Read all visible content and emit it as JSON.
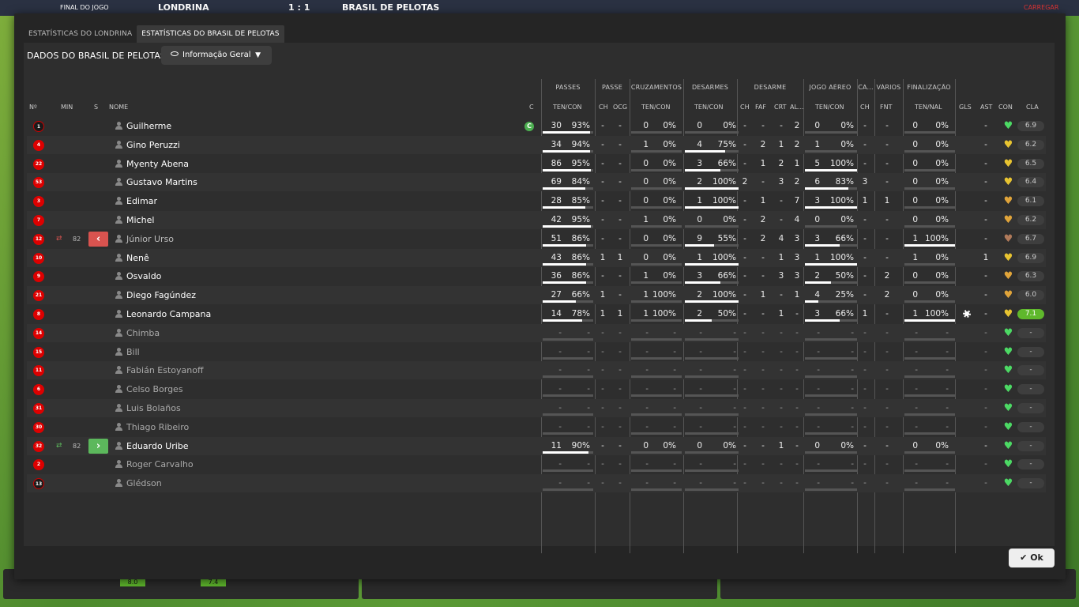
{
  "topbar": {
    "left_label": "FINAL DO JOGO",
    "home_team": "LONDRINA",
    "score": "1 : 1",
    "away_team": "BRASIL DE PELOTAS",
    "right_label": "CARREGAR"
  },
  "tabs": [
    {
      "label": "ESTATÍSTICAS DO LONDRINA",
      "active": false
    },
    {
      "label": "ESTATÍSTICAS DO BRASIL DE PELOTAS",
      "active": true
    }
  ],
  "section_title": "DADOS DO BRASIL DE PELOTAS",
  "view_dropdown": {
    "value": "Informação Geral",
    "icon": "eye-icon"
  },
  "groups": [
    "PASSES",
    "PASSE",
    "CRUZAMENTOS",
    "DESARMES",
    "DESARME",
    "JOGO AÉREO",
    "CA...",
    "VÁRIOS",
    "FINALIZAÇÃO"
  ],
  "columns": {
    "num": "Nº",
    "min": "MIN",
    "s": "S",
    "name": "NOME",
    "cap": "C",
    "pass_tc": "TEN/CON",
    "pass_ch": "CH",
    "pass_ocg": "OCG",
    "cross_tc": "TEN/CON",
    "tack_tc": "TEN/CON",
    "des_ch": "CH",
    "des_faf": "FAF",
    "des_crt": "CRT",
    "des_al": "AL...",
    "air_tc": "TEN/CON",
    "ca_ch": "CH",
    "var_fnt": "FNT",
    "fin_tn": "TEN/NAL",
    "gls": "GLS",
    "ast": "AST",
    "con": "CON",
    "cla": "CLA"
  },
  "players": [
    {
      "num": "1",
      "gk": true,
      "name": "Guilherme",
      "cap": "C",
      "p": [
        "30",
        "93%"
      ],
      "pch": "-",
      "pocg": "-",
      "cr": [
        "0",
        "0%"
      ],
      "tk": [
        "0",
        "0%"
      ],
      "d": [
        "-",
        "-",
        "-",
        "2"
      ],
      "air": [
        "0",
        "0%"
      ],
      "cach": "-",
      "fnt": "-",
      "fin": [
        "0",
        "0%"
      ],
      "gls": "",
      "ast": "-",
      "con": "green",
      "cla": "6.9",
      "pass_pct": 0.93,
      "tk_pct": 0,
      "air_pct": 0,
      "fin_pct": 0
    },
    {
      "num": "4",
      "name": "Gino Peruzzi",
      "p": [
        "34",
        "94%"
      ],
      "pch": "-",
      "pocg": "-",
      "cr": [
        "1",
        "0%"
      ],
      "tk": [
        "4",
        "75%"
      ],
      "d": [
        "-",
        "2",
        "1",
        "2"
      ],
      "air": [
        "1",
        "0%"
      ],
      "cach": "-",
      "fnt": "-",
      "fin": [
        "0",
        "0%"
      ],
      "gls": "",
      "ast": "-",
      "con": "gold",
      "cla": "6.2",
      "pass_pct": 0.94,
      "tk_pct": 0.75,
      "air_pct": 0,
      "fin_pct": 0
    },
    {
      "num": "22",
      "name": "Myenty Abena",
      "p": [
        "86",
        "95%"
      ],
      "pch": "-",
      "pocg": "-",
      "cr": [
        "0",
        "0%"
      ],
      "tk": [
        "3",
        "66%"
      ],
      "d": [
        "-",
        "1",
        "2",
        "1"
      ],
      "air": [
        "5",
        "100%"
      ],
      "cach": "-",
      "fnt": "-",
      "fin": [
        "0",
        "0%"
      ],
      "gls": "",
      "ast": "-",
      "con": "gold",
      "cla": "6.5",
      "pass_pct": 0.95,
      "tk_pct": 0.66,
      "air_pct": 1,
      "fin_pct": 0
    },
    {
      "num": "53",
      "name": "Gustavo Martins",
      "p": [
        "69",
        "84%"
      ],
      "pch": "-",
      "pocg": "-",
      "cr": [
        "0",
        "0%"
      ],
      "tk": [
        "2",
        "100%"
      ],
      "d": [
        "2",
        "-",
        "3",
        "2"
      ],
      "air": [
        "6",
        "83%"
      ],
      "cach": "3",
      "fnt": "-",
      "fin": [
        "0",
        "0%"
      ],
      "gls": "",
      "ast": "-",
      "con": "gold",
      "cla": "6.4",
      "pass_pct": 0.84,
      "tk_pct": 1,
      "air_pct": 0.83,
      "fin_pct": 0
    },
    {
      "num": "3",
      "name": "Edimar",
      "p": [
        "28",
        "85%"
      ],
      "pch": "-",
      "pocg": "-",
      "cr": [
        "0",
        "0%"
      ],
      "tk": [
        "1",
        "100%"
      ],
      "d": [
        "-",
        "1",
        "-",
        "7"
      ],
      "air": [
        "3",
        "100%"
      ],
      "cach": "1",
      "fnt": "1",
      "fin": [
        "0",
        "0%"
      ],
      "gls": "",
      "ast": "-",
      "con": "orange",
      "cla": "6.1",
      "pass_pct": 0.85,
      "tk_pct": 1,
      "air_pct": 1,
      "fin_pct": 0
    },
    {
      "num": "7",
      "name": "Michel",
      "p": [
        "42",
        "95%"
      ],
      "pch": "-",
      "pocg": "-",
      "cr": [
        "1",
        "0%"
      ],
      "tk": [
        "0",
        "0%"
      ],
      "d": [
        "-",
        "2",
        "-",
        "4"
      ],
      "air": [
        "0",
        "0%"
      ],
      "cach": "-",
      "fnt": "-",
      "fin": [
        "0",
        "0%"
      ],
      "gls": "",
      "ast": "-",
      "con": "orange",
      "cla": "6.2",
      "pass_pct": 0.95,
      "tk_pct": 0,
      "air_pct": 0,
      "fin_pct": 0
    },
    {
      "num": "12",
      "name": "Júnior Urso",
      "sub": "out",
      "min": "82",
      "faded": true,
      "p": [
        "51",
        "86%"
      ],
      "pch": "-",
      "pocg": "-",
      "cr": [
        "0",
        "0%"
      ],
      "tk": [
        "9",
        "55%"
      ],
      "d": [
        "-",
        "2",
        "4",
        "3"
      ],
      "air": [
        "3",
        "66%"
      ],
      "cach": "-",
      "fnt": "-",
      "fin": [
        "1",
        "100%"
      ],
      "gls": "",
      "ast": "-",
      "con": "brown",
      "cla": "6.7",
      "pass_pct": 0.86,
      "tk_pct": 0.55,
      "air_pct": 0.66,
      "fin_pct": 1
    },
    {
      "num": "10",
      "name": "Nenê",
      "p": [
        "43",
        "86%"
      ],
      "pch": "1",
      "pocg": "1",
      "cr": [
        "0",
        "0%"
      ],
      "tk": [
        "1",
        "100%"
      ],
      "d": [
        "-",
        "-",
        "1",
        "3"
      ],
      "air": [
        "1",
        "100%"
      ],
      "cach": "-",
      "fnt": "-",
      "fin": [
        "1",
        "0%"
      ],
      "gls": "",
      "ast": "1",
      "con": "gold",
      "cla": "6.9",
      "pass_pct": 0.86,
      "tk_pct": 1,
      "air_pct": 1,
      "fin_pct": 0
    },
    {
      "num": "9",
      "name": "Osvaldo",
      "p": [
        "36",
        "86%"
      ],
      "pch": "-",
      "pocg": "-",
      "cr": [
        "1",
        "0%"
      ],
      "tk": [
        "3",
        "66%"
      ],
      "d": [
        "-",
        "-",
        "3",
        "3"
      ],
      "air": [
        "2",
        "50%"
      ],
      "cach": "-",
      "fnt": "2",
      "fin": [
        "0",
        "0%"
      ],
      "gls": "",
      "ast": "-",
      "con": "orange",
      "cla": "6.3",
      "pass_pct": 0.86,
      "tk_pct": 0.66,
      "air_pct": 0.5,
      "fin_pct": 0
    },
    {
      "num": "21",
      "name": "Diego Fagúndez",
      "p": [
        "27",
        "66%"
      ],
      "pch": "1",
      "pocg": "-",
      "cr": [
        "1",
        "100%"
      ],
      "tk": [
        "2",
        "100%"
      ],
      "d": [
        "-",
        "1",
        "-",
        "1"
      ],
      "air": [
        "4",
        "25%"
      ],
      "cach": "-",
      "fnt": "2",
      "fin": [
        "0",
        "0%"
      ],
      "gls": "",
      "ast": "-",
      "con": "orange",
      "cla": "6.0",
      "pass_pct": 0.66,
      "tk_pct": 1,
      "air_pct": 0.25,
      "fin_pct": 0
    },
    {
      "num": "8",
      "name": "Leonardo Campana",
      "p": [
        "14",
        "78%"
      ],
      "pch": "1",
      "pocg": "1",
      "cr": [
        "1",
        "100%"
      ],
      "tk": [
        "2",
        "50%"
      ],
      "d": [
        "-",
        "-",
        "1",
        "-"
      ],
      "air": [
        "3",
        "66%"
      ],
      "cach": "1",
      "fnt": "-",
      "fin": [
        "1",
        "100%"
      ],
      "gls": "ball",
      "ast": "-",
      "con": "gold",
      "cla": "7.1",
      "best": true,
      "pass_pct": 0.78,
      "tk_pct": 0.5,
      "air_pct": 0.66,
      "fin_pct": 1
    },
    {
      "num": "14",
      "name": "Chimba",
      "dim": true,
      "con": "green",
      "cla": "-"
    },
    {
      "num": "15",
      "name": "Bill",
      "dim": true,
      "con": "green",
      "cla": "-"
    },
    {
      "num": "11",
      "name": "Fabián Estoyanoff",
      "dim": true,
      "con": "green",
      "cla": "-"
    },
    {
      "num": "6",
      "name": "Celso Borges",
      "dim": true,
      "con": "green",
      "cla": "-"
    },
    {
      "num": "31",
      "name": "Luis Bolaños",
      "dim": true,
      "con": "green",
      "cla": "-"
    },
    {
      "num": "30",
      "name": "Thiago Ribeiro",
      "dim": true,
      "con": "green",
      "cla": "-"
    },
    {
      "num": "32",
      "name": "Eduardo Uribe",
      "sub": "in",
      "min": "82",
      "p": [
        "11",
        "90%"
      ],
      "pch": "-",
      "pocg": "-",
      "cr": [
        "0",
        "0%"
      ],
      "tk": [
        "0",
        "0%"
      ],
      "d": [
        "-",
        "-",
        "1",
        "-"
      ],
      "air": [
        "0",
        "0%"
      ],
      "cach": "-",
      "fnt": "-",
      "fin": [
        "0",
        "0%"
      ],
      "gls": "",
      "ast": "-",
      "con": "green",
      "cla": "-",
      "pass_pct": 0.9,
      "tk_pct": 0,
      "air_pct": 0,
      "fin_pct": 0
    },
    {
      "num": "2",
      "name": "Roger Carvalho",
      "dim": true,
      "con": "green",
      "cla": "-"
    },
    {
      "num": "13",
      "gk": true,
      "name": "Glédson",
      "dim": true,
      "con": "green",
      "cla": "-"
    }
  ],
  "bottom_ratings": [
    "8.0",
    "7.4"
  ],
  "ok_label": "Ok",
  "colors": {
    "green": "#4cd964",
    "gold": "#e8c431",
    "orange": "#e0a43a",
    "brown": "#b07a5a",
    "best": "#5fb82c"
  }
}
